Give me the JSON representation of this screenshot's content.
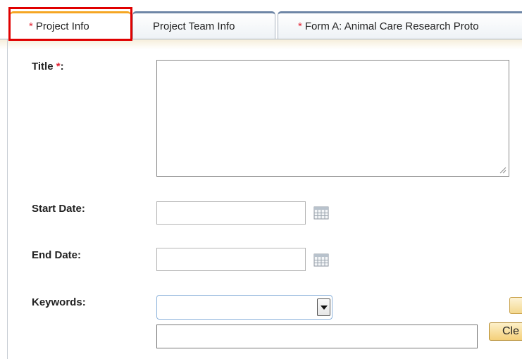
{
  "tabs": [
    {
      "label": "Project Info",
      "required": true,
      "active": true
    },
    {
      "label": "Project Team Info",
      "required": false,
      "active": false
    },
    {
      "label": "Form A: Animal Care Research Proto",
      "required": true,
      "active": false
    }
  ],
  "required_marker": "*",
  "form": {
    "title_label": "Title",
    "title_required_marker": "*",
    "title_label_suffix": ":",
    "title_value": "",
    "start_date_label": "Start Date:",
    "start_date_value": "",
    "end_date_label": "End Date:",
    "end_date_value": "",
    "keywords_label": "Keywords:",
    "keywords_value": "",
    "keyword_text_value": "",
    "clear_button_label": "Cle"
  },
  "colors": {
    "active_tab_accent": "#f5a623",
    "inactive_tab_accent": "#6e86a6",
    "required_marker": "#e32636",
    "highlight_box": "#e00000"
  },
  "icons": {
    "calendar": "calendar-icon",
    "dropdown": "chevron-down-icon",
    "resize": "resize-grip-icon"
  }
}
